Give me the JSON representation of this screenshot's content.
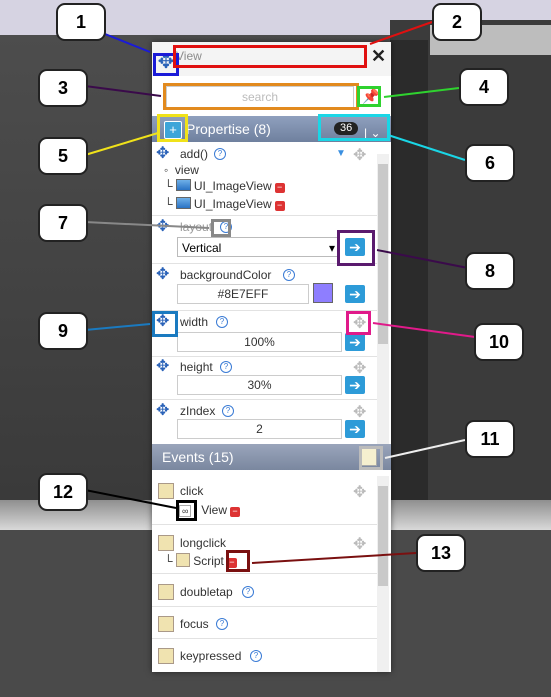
{
  "window": {
    "title_placeholder": "View"
  },
  "search": {
    "placeholder": "search"
  },
  "properties": {
    "header_label": "Propertise (8)",
    "count_badge": "36",
    "add_label": "add()",
    "add_sub_label": "view",
    "add_children": [
      "UI_ImageView",
      "UI_ImageView"
    ],
    "layout_label": "layout",
    "layout_value": "Vertical",
    "bg_label": "backgroundColor",
    "bg_value": "#8E7EFF",
    "width_label": "width",
    "width_value": "100%",
    "height_label": "height",
    "height_value": "30%",
    "zindex_label": "zIndex",
    "zindex_value": "2"
  },
  "events": {
    "header_label": "Events (15)",
    "items": [
      {
        "label": "click",
        "link": "View"
      },
      {
        "label": "longclick",
        "link": "Script"
      },
      {
        "label": "doubletap"
      },
      {
        "label": "focus"
      },
      {
        "label": "keypressed"
      }
    ]
  },
  "callouts": [
    "1",
    "2",
    "3",
    "4",
    "5",
    "6",
    "7",
    "8",
    "9",
    "10",
    "11",
    "12",
    "13"
  ],
  "colors": {
    "accent_blue": "#2d9bd8",
    "swatch": "#8E7EFF",
    "section_header": "#7f8fae"
  }
}
